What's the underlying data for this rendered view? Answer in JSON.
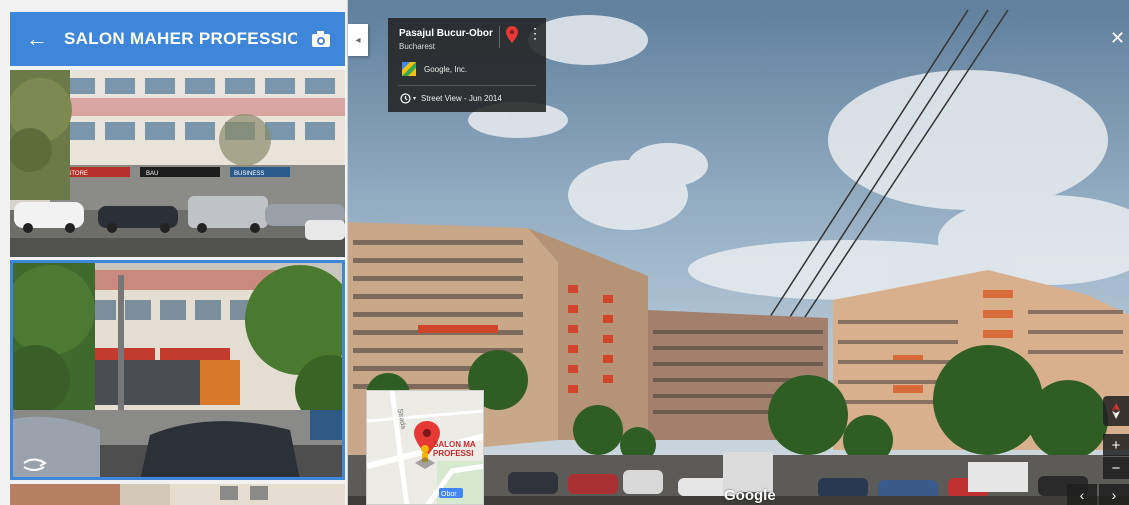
{
  "header": {
    "title": "SALON MAHER PROFESSIO...",
    "back_icon": "arrow-left-icon",
    "camera_icon": "add-photo-icon",
    "accent_color": "#3e86d9"
  },
  "location_card": {
    "place_name": "Pasajul Bucur-Obor",
    "city": "Bucharest",
    "provider": "Google, Inc.",
    "date_label": "Street View - Jun 2014"
  },
  "minimap": {
    "pin_label_line1": "SALON MA",
    "pin_label_line2": "PROFESSI",
    "street_label": "Strada",
    "area_label": "Obor"
  },
  "controls": {
    "close": "✕",
    "zoom_in": "+",
    "zoom_out": "−",
    "nav_left": "‹",
    "nav_right": "›",
    "collapse": "◂"
  },
  "shop_signs": {
    "sign_a": "LUX STORE",
    "sign_b": "BAU",
    "sign_c": "BUSINESS"
  },
  "watermark": "Google"
}
